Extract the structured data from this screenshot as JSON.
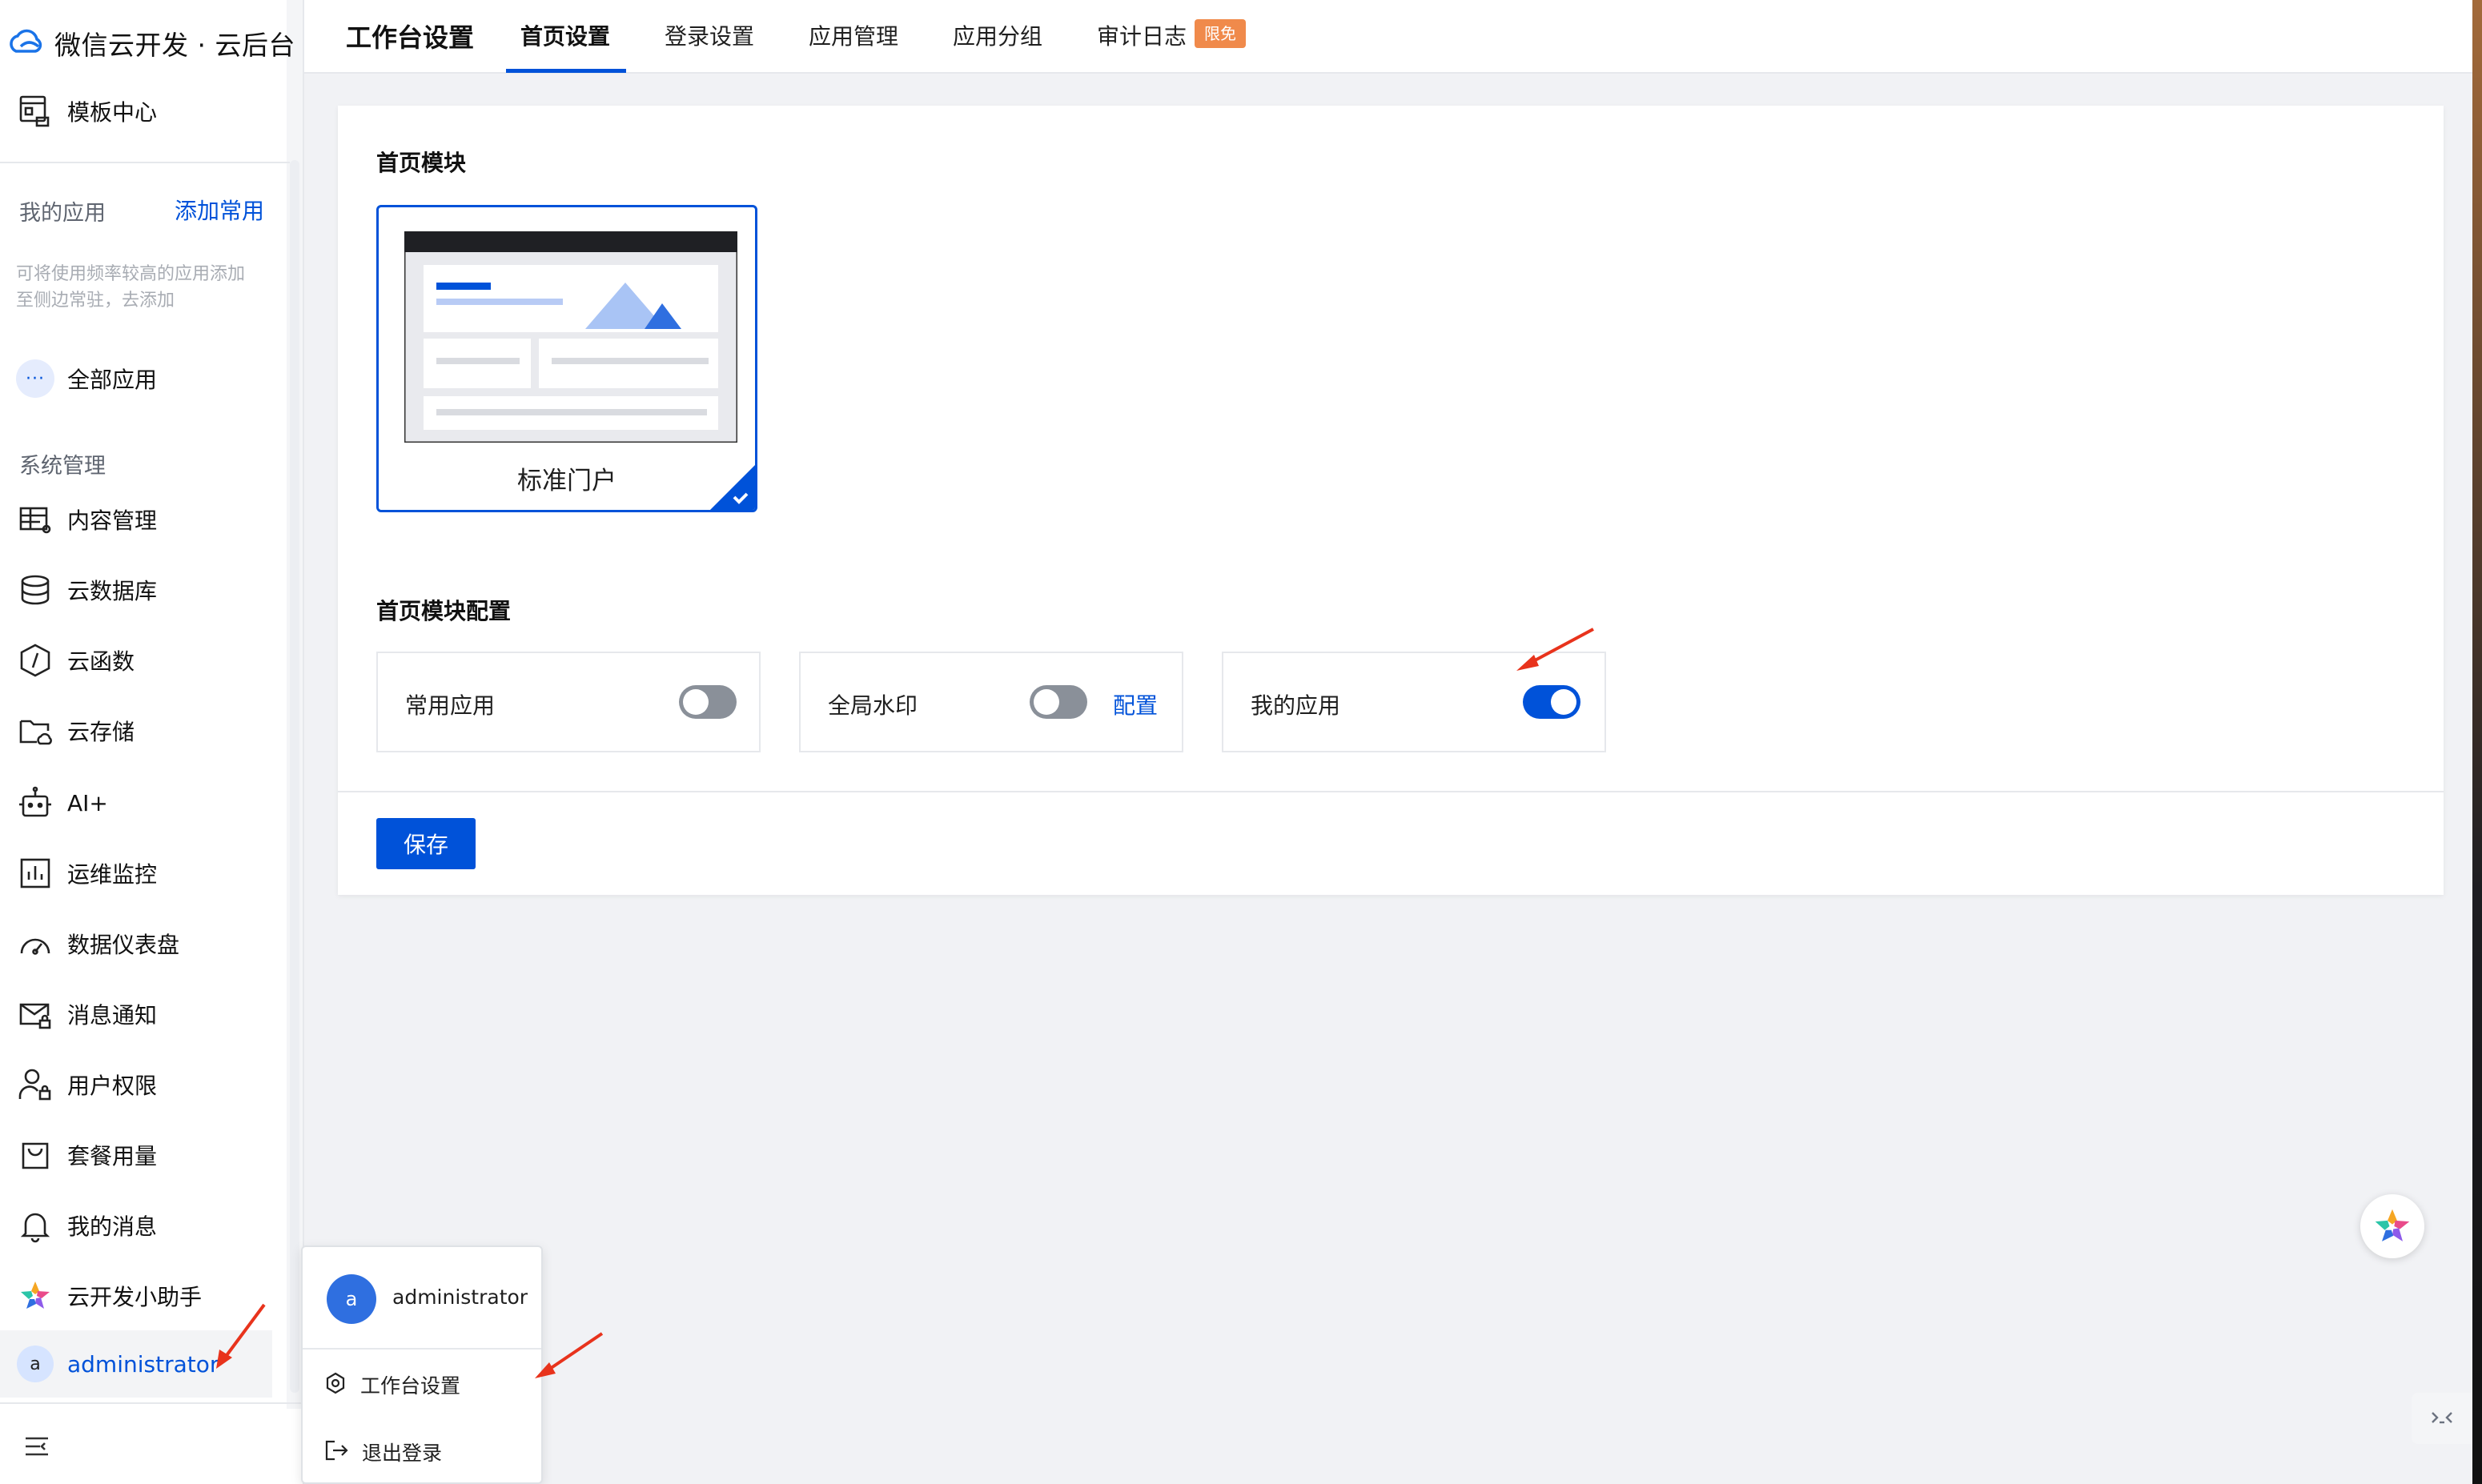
{
  "brand": {
    "name": "微信云开发 · 云后台"
  },
  "sidebar": {
    "template_center": "模板中心",
    "my_apps_title": "我的应用",
    "add_common": "添加常用",
    "my_apps_hint": "可将使用频率较高的应用添加至侧边常驻，去添加",
    "all_apps": "全部应用",
    "all_apps_icon": "···",
    "system_title": "系统管理",
    "items": [
      {
        "label": "内容管理",
        "icon": "table-icon"
      },
      {
        "label": "云数据库",
        "icon": "database-icon"
      },
      {
        "label": "云函数",
        "icon": "function-icon"
      },
      {
        "label": "云存储",
        "icon": "folder-cloud-icon"
      },
      {
        "label": "AI+",
        "icon": "robot-icon"
      },
      {
        "label": "运维监控",
        "icon": "bar-chart-icon"
      },
      {
        "label": "数据仪表盘",
        "icon": "gauge-icon"
      },
      {
        "label": "消息通知",
        "icon": "mail-lock-icon"
      },
      {
        "label": "用户权限",
        "icon": "user-lock-icon"
      },
      {
        "label": "套餐用量",
        "icon": "bag-icon"
      },
      {
        "label": "我的消息",
        "icon": "bell-icon"
      },
      {
        "label": "云开发小助手",
        "icon": "assistant-icon"
      }
    ],
    "user": {
      "avatar": "a",
      "name": "administrator"
    }
  },
  "topbar": {
    "title": "工作台设置",
    "tabs": [
      {
        "label": "首页设置",
        "active": true
      },
      {
        "label": "登录设置",
        "active": false
      },
      {
        "label": "应用管理",
        "active": false
      },
      {
        "label": "应用分组",
        "active": false
      },
      {
        "label": "审计日志",
        "active": false
      }
    ],
    "badge": "限免"
  },
  "main": {
    "home_module_title": "首页模块",
    "template_label": "标准门户",
    "template_selected": true,
    "config_title": "首页模块配置",
    "configs": [
      {
        "label": "常用应用",
        "enabled": false
      },
      {
        "label": "全局水印",
        "enabled": false,
        "link": "配置"
      },
      {
        "label": "我的应用",
        "enabled": true
      }
    ],
    "save": "保存"
  },
  "popup": {
    "avatar": "a",
    "name": "administrator",
    "items": [
      {
        "label": "工作台设置",
        "icon": "gear-icon"
      },
      {
        "label": "退出登录",
        "icon": "logout-icon"
      }
    ]
  },
  "colors": {
    "primary": "#0052d9",
    "badge": "#f08a4b",
    "annotation": "#e8331c"
  }
}
